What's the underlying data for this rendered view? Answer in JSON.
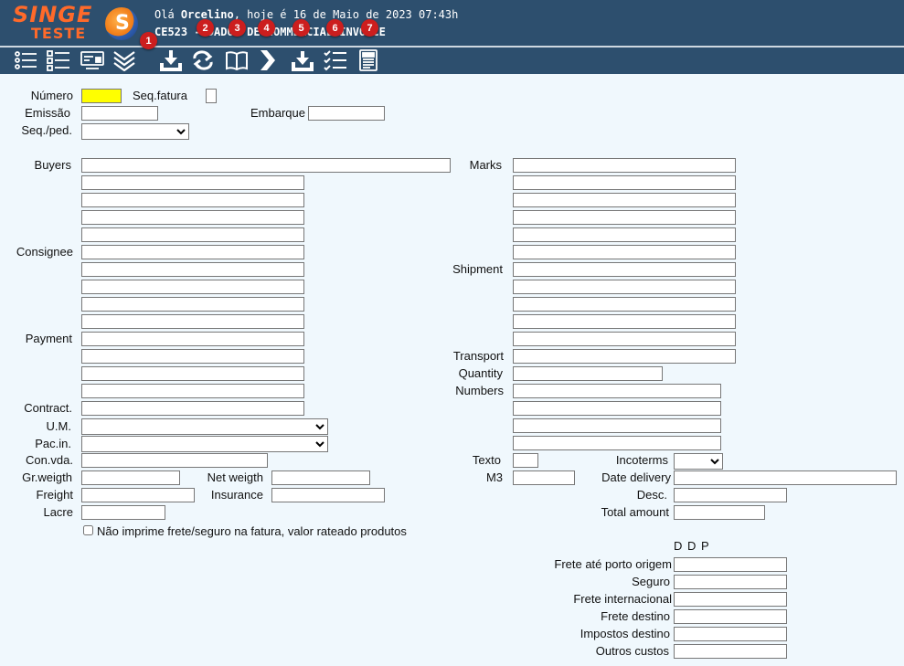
{
  "header": {
    "logo_line1": "SINGE",
    "logo_line2": "TESTE",
    "greeting_prefix": "Olá ",
    "user": "Orcelino",
    "greeting_suffix": ", hoje é 16 de Maio de 2023 07:43h",
    "screen_title": "CE523 - DADOS DE COMMERCIAL INVOICE"
  },
  "toolbar": {
    "badges": [
      "1",
      "2",
      "3",
      "4",
      "5",
      "6",
      "7"
    ]
  },
  "labels": {
    "numero": "Número",
    "seq_fatura": "Seq.fatura",
    "emissao": "Emissão",
    "embarque": "Embarque",
    "seq_ped": "Seq./ped.",
    "buyers": "Buyers",
    "consignee": "Consignee",
    "payment": "Payment",
    "contract": "Contract.",
    "um": "U.M.",
    "pac_in": "Pac.in.",
    "con_vda": "Con.vda.",
    "gr_weigth": "Gr.weigth",
    "net_weigth": "Net weigth",
    "freight": "Freight",
    "insurance": "Insurance",
    "lacre": "Lacre",
    "marks": "Marks",
    "shipment": "Shipment",
    "transport": "Transport",
    "quantity": "Quantity",
    "numbers": "Numbers",
    "texto": "Texto",
    "incoterms": "Incoterms",
    "m3": "M3",
    "date_delivery": "Date delivery",
    "desc": "Desc.",
    "total_amount": "Total amount",
    "ddp": "D D P",
    "frete_porto_origem": "Frete até porto origem",
    "seguro": "Seguro",
    "frete_internacional": "Frete internacional",
    "frete_destino": "Frete destino",
    "impostos_destino": "Impostos destino",
    "outros_custos": "Outros custos"
  },
  "checkbox": {
    "label": "Não imprime frete/seguro na fatura, valor rateado produtos",
    "checked": false
  },
  "selects": {
    "seq_ped": "",
    "um": "",
    "pac_in": "",
    "incoterms": ""
  },
  "colors": {
    "header_bg": "#2d4f6e",
    "page_bg": "#f0f8fd",
    "logo": "#ff6a2a",
    "badge": "#cc1e1e",
    "numero_field": "#ffff00"
  }
}
